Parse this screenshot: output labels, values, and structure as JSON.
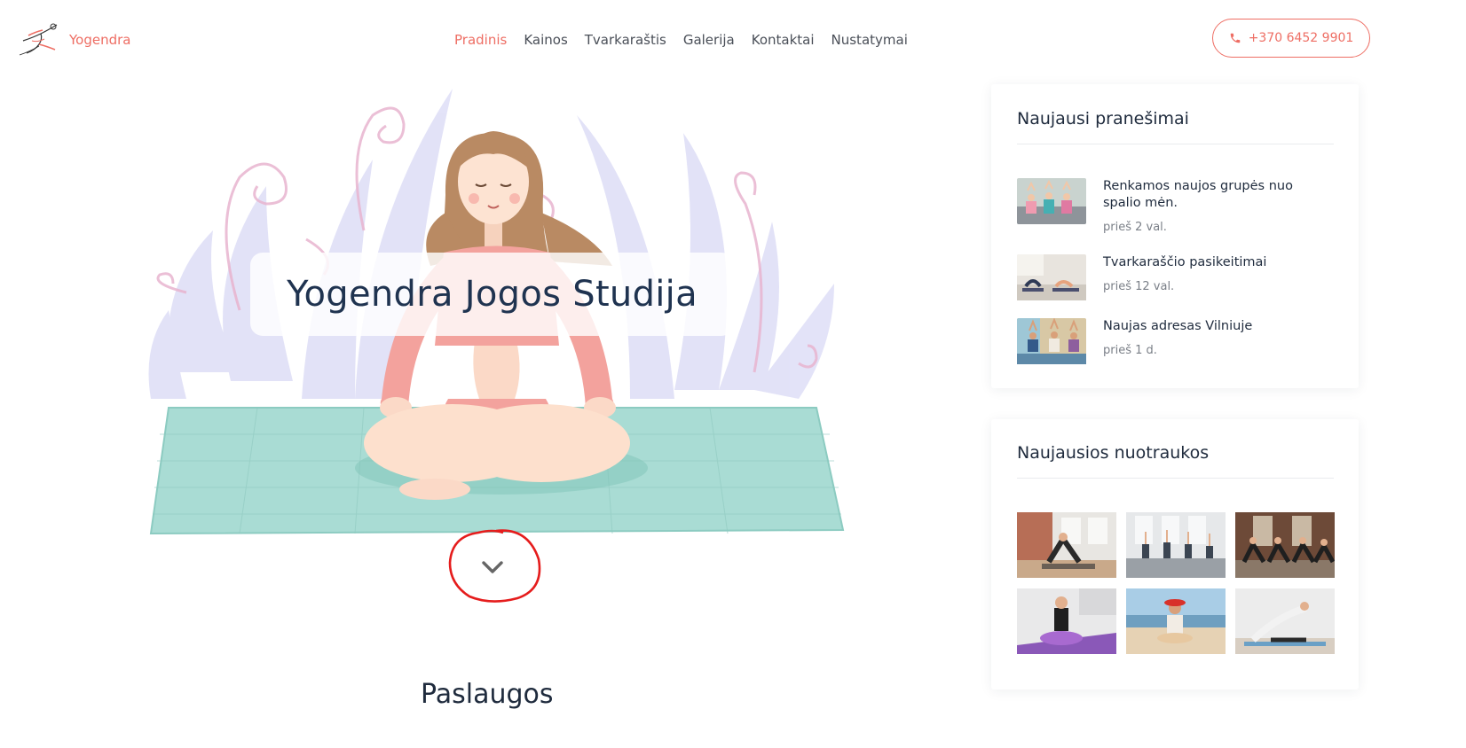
{
  "header": {
    "logo_text": "Yogendra",
    "nav": [
      {
        "label": "Pradinis",
        "active": true
      },
      {
        "label": "Kainos",
        "active": false
      },
      {
        "label": "Tvarkaraštis",
        "active": false
      },
      {
        "label": "Galerija",
        "active": false
      },
      {
        "label": "Kontaktai",
        "active": false
      },
      {
        "label": "Nustatymai",
        "active": false
      }
    ],
    "phone": "+370 6452 9901",
    "phone_icon": "phone-icon"
  },
  "hero": {
    "title": "Yogendra Jogos Studija",
    "scroll_icon": "chevron-down-icon"
  },
  "services": {
    "title": "Paslaugos"
  },
  "sidebar": {
    "posts_title": "Naujausi pranešimai",
    "posts": [
      {
        "title": "Renkamos naujos grupės nuo spalio mėn.",
        "time": "prieš 2 val."
      },
      {
        "title": "Tvarkaraščio pasikeitimai",
        "time": "prieš 12 val."
      },
      {
        "title": "Naujas adresas Vilniuje",
        "time": "prieš 1 d."
      }
    ],
    "photos_title": "Naujausios nuotraukos"
  },
  "colors": {
    "accent": "#ee6e64",
    "heading": "#1f2b3d",
    "muted": "#7a7f87",
    "mat": "#8fd2c8",
    "top": "#f3a29d",
    "hair": "#b98a63"
  }
}
